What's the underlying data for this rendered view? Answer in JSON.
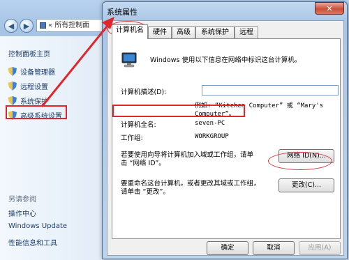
{
  "background_window": {
    "address_breadcrumb": "所有控制面",
    "nav_prefix": "«",
    "sidebar": {
      "home_link": "控制面板主页",
      "items": [
        {
          "label": "设备管理器",
          "icon": "shield-icon"
        },
        {
          "label": "远程设置",
          "icon": "shield-icon"
        },
        {
          "label": "系统保护",
          "icon": "shield-icon"
        },
        {
          "label": "高级系统设置",
          "icon": "shield-icon"
        }
      ],
      "see_also_heading": "另请参阅",
      "see_also_links": [
        "操作中心",
        "Windows Update",
        "性能信息和工具"
      ]
    }
  },
  "dialog": {
    "title": "系统属性",
    "close_glyph": "✕",
    "tabs": [
      "计算机名",
      "硬件",
      "高级",
      "系统保护",
      "远程"
    ],
    "active_tab": "计算机名",
    "intro_text": "Windows 使用以下信息在网络中标识这台计算机。",
    "description_label": "计算机描述(D):",
    "description_value": "",
    "example_text_line1": "例如: “Kitchen Computer” 或 “Mary's",
    "example_text_line2": "Computer”。",
    "full_name_label": "计算机全名:",
    "full_name_value": "seven-PC",
    "workgroup_label": "工作组:",
    "workgroup_value": "WORKGROUP",
    "network_id_text_line1": "若要使用向导将计算机加入域或工作组，请单",
    "network_id_text_line2": "击 “网络 ID”。",
    "network_id_button": "网络 ID(N)...",
    "change_text_line1": "要重命名这台计算机，或者更改其域或工作组，",
    "change_text_line2": "请单击 “更改”。",
    "change_button": "更改(C)...",
    "ok_button": "确定",
    "cancel_button": "取消",
    "apply_button": "应用(A)"
  },
  "annotation_color": "#e0262b"
}
